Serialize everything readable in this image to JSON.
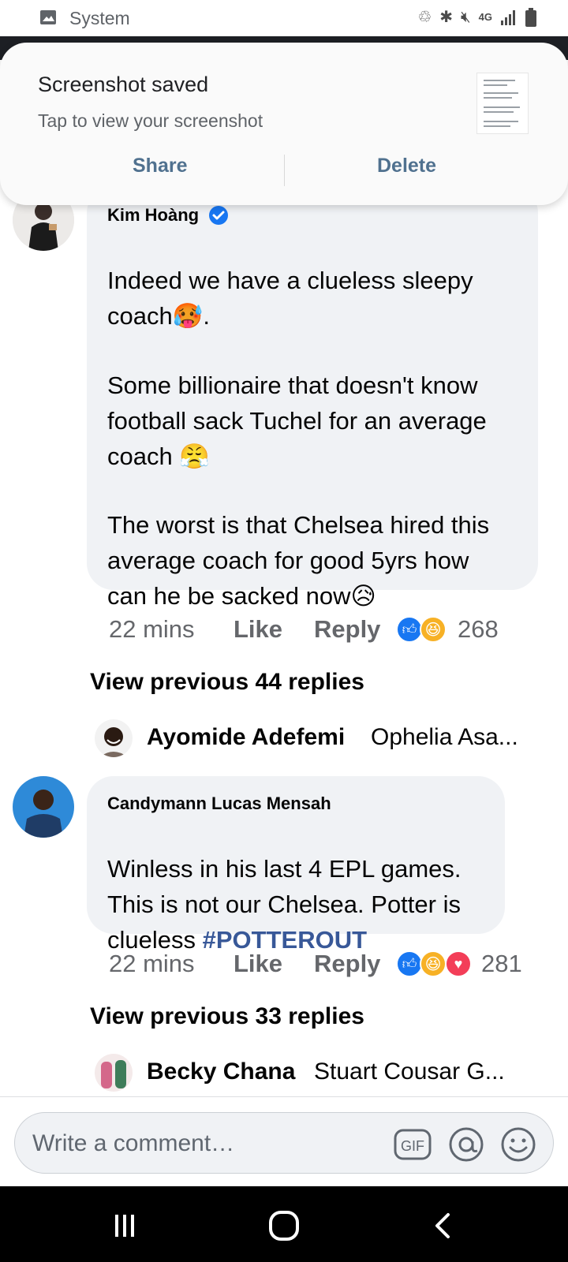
{
  "status_bar": {
    "label": "System",
    "icons": [
      "recycle-icon",
      "bluetooth-icon",
      "mute-icon",
      "4g-icon",
      "signal-icon",
      "battery-icon"
    ],
    "network": "4G"
  },
  "notification": {
    "title": "Screenshot saved",
    "subtitle": "Tap to view your screenshot",
    "share_label": "Share",
    "delete_label": "Delete"
  },
  "comments": [
    {
      "author": "Kim Hoàng",
      "verified": true,
      "text_p1": "Indeed we have a clueless sleepy\ncoach",
      "emoji_1": "🥵",
      "text_p1_end": ".",
      "text_p2": "Some billionaire that doesn't know\nfootball sack Tuchel for an average\ncoach ",
      "emoji_2": "😤",
      "text_p3": "The worst is that Chelsea hired this\naverage coach for good 5yrs how\ncan he be sacked now",
      "emoji_3": "😥",
      "time": "22 mins",
      "like_label": "Like",
      "reply_label": "Reply",
      "reaction_count": "268",
      "reactions": [
        "like-icon",
        "haha-icon"
      ],
      "view_previous": "View previous 44 replies",
      "preview_name": "Ayomide Adefemi",
      "preview_text": "Ophelia Asa..."
    },
    {
      "author": "Candymann Lucas Mensah",
      "verified": false,
      "text": "Winless in his last 4 EPL games.\nThis is not our Chelsea. Potter is\nclueless ",
      "hashtag": "#POTTEROUT",
      "time": "22 mins",
      "like_label": "Like",
      "reply_label": "Reply",
      "reaction_count": "281",
      "reactions": [
        "like-icon",
        "haha-icon",
        "love-icon"
      ],
      "view_previous": "View previous 33 replies",
      "preview_name": "Becky Chana",
      "preview_text": "Stuart Cousar G..."
    }
  ],
  "composer": {
    "placeholder": "Write a comment…",
    "gif_label": "GIF",
    "icons": [
      "gif-icon",
      "mention-icon",
      "emoji-icon"
    ]
  },
  "colors": {
    "bubble": "#f0f2f5",
    "link_blue": "#385898",
    "like_blue": "#1877f2",
    "love_red": "#f33e58",
    "notif_button": "#50718f"
  }
}
